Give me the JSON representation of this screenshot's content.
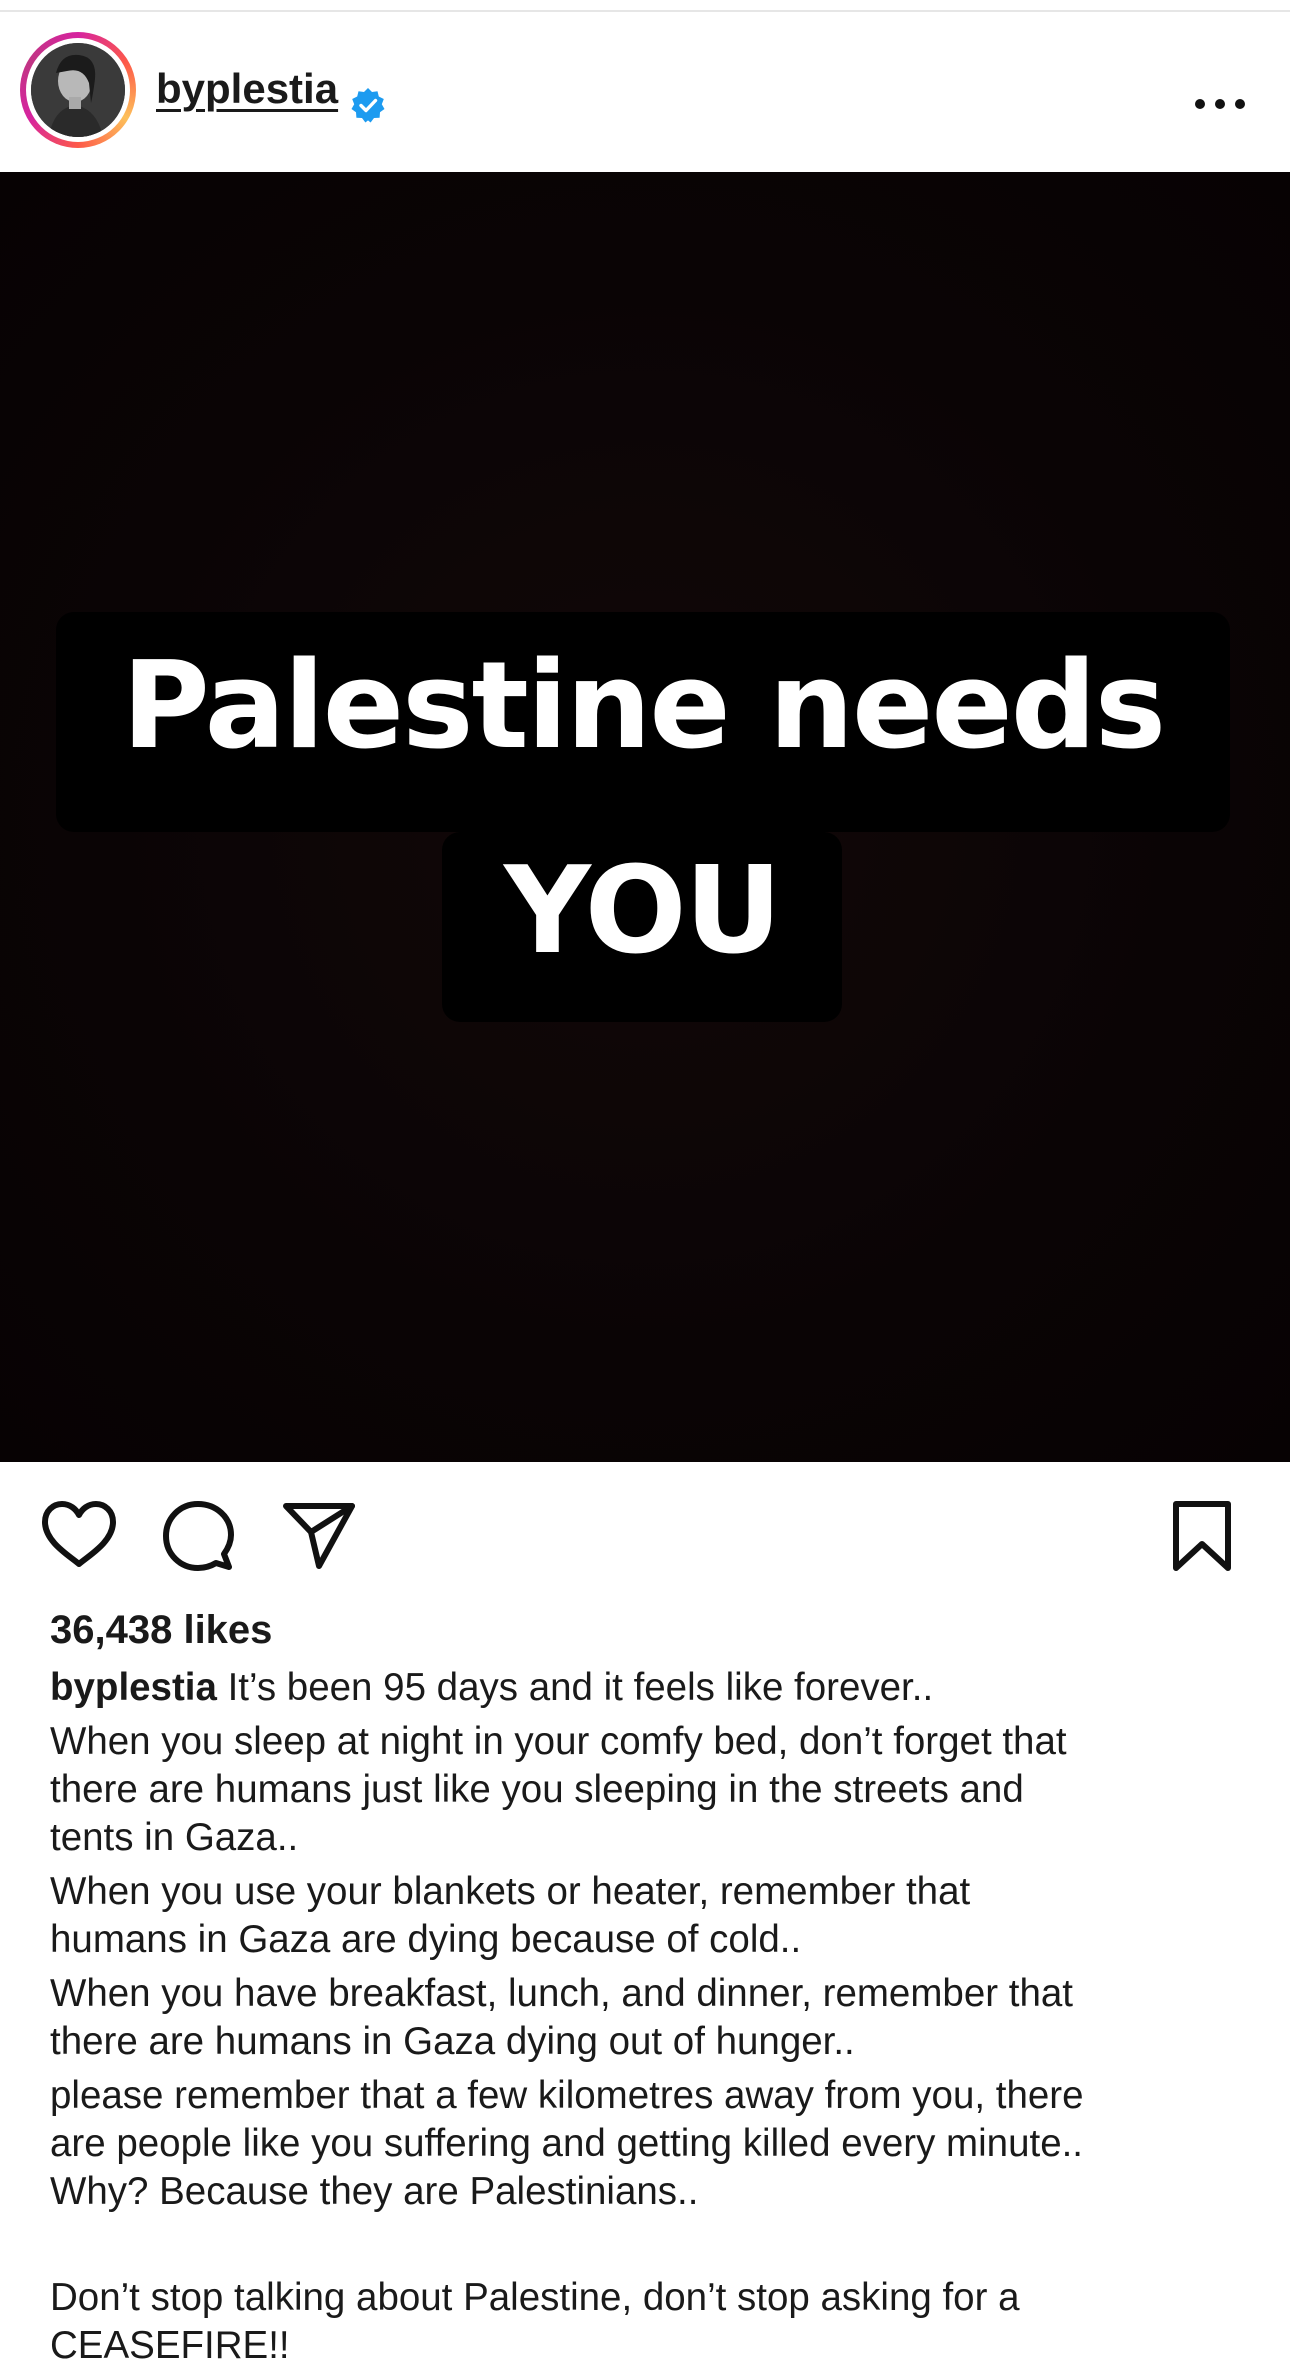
{
  "post": {
    "username": "byplestia",
    "verified": true,
    "image": {
      "line1": "Palestine needs",
      "line2": "YOU",
      "background_color": "#0a0405"
    },
    "likes": "36,438 likes",
    "caption": {
      "username": "byplestia",
      "first_line": "It’s been 95 days and it feels like forever..",
      "paragraphs": [
        "When you sleep at night in your comfy bed, don’t forget that\nthere are humans just like you sleeping in the streets and\ntents in Gaza..",
        "When you use your blankets or heater, remember that\nhumans in Gaza are dying because of cold..",
        "When you have breakfast, lunch, and dinner, remember that\nthere are humans in Gaza dying out of hunger..",
        "please remember that a few kilometres away from you, there\nare people like you suffering and getting killed every minute..\nWhy? Because they are Palestinians..",
        "Don’t stop talking about Palestine, don’t stop asking for a\nCEASEFIRE!!"
      ]
    }
  },
  "icons": {
    "verified": "verified-badge-icon",
    "more": "more-options-icon",
    "like": "heart-icon",
    "comment": "comment-bubble-icon",
    "share": "paper-plane-icon",
    "save": "bookmark-icon"
  },
  "colors": {
    "verified_blue": "#1d9bf0",
    "text": "#1a1a1a"
  }
}
